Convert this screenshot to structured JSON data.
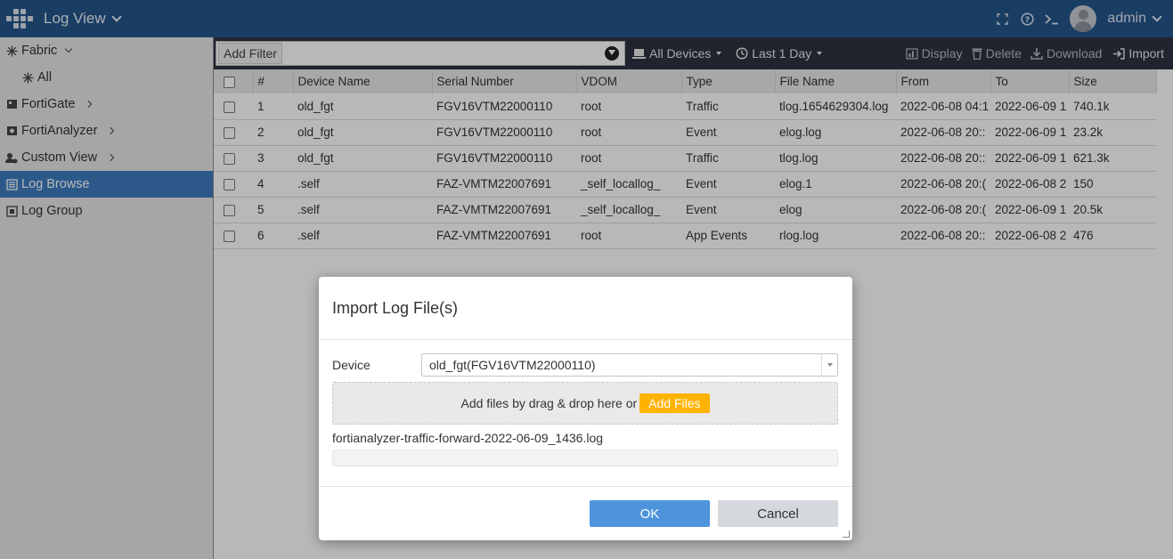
{
  "header": {
    "app_title": "Log View",
    "user": "admin"
  },
  "sidebar": {
    "items": [
      {
        "label": "Fabric"
      },
      {
        "label": "All"
      },
      {
        "label": "FortiGate"
      },
      {
        "label": "FortiAnalyzer"
      },
      {
        "label": "Custom View"
      },
      {
        "label": "Log Browse"
      },
      {
        "label": "Log Group"
      }
    ]
  },
  "toolbar": {
    "add_filter": "Add Filter",
    "devices": "All Devices",
    "time_range": "Last 1 Day",
    "display": "Display",
    "delete": "Delete",
    "download": "Download",
    "import": "Import"
  },
  "table": {
    "columns": [
      "#",
      "Device Name",
      "Serial Number",
      "VDOM",
      "Type",
      "File Name",
      "From",
      "To",
      "Size"
    ],
    "rows": [
      [
        "1",
        "old_fgt",
        "FGV16VTM22000110",
        "root",
        "Traffic",
        "tlog.1654629304.log",
        "2022-06-08 04:1",
        "2022-06-09 1",
        "740.1k"
      ],
      [
        "2",
        "old_fgt",
        "FGV16VTM22000110",
        "root",
        "Event",
        "elog.log",
        "2022-06-08 20::",
        "2022-06-09 1",
        "23.2k"
      ],
      [
        "3",
        "old_fgt",
        "FGV16VTM22000110",
        "root",
        "Traffic",
        "tlog.log",
        "2022-06-08 20::",
        "2022-06-09 1",
        "621.3k"
      ],
      [
        "4",
        ".self",
        "FAZ-VMTM22007691",
        "_self_locallog_",
        "Event",
        "elog.1",
        "2022-06-08 20:(",
        "2022-06-08 2",
        "150"
      ],
      [
        "5",
        ".self",
        "FAZ-VMTM22007691",
        "_self_locallog_",
        "Event",
        "elog",
        "2022-06-08 20:(",
        "2022-06-09 1",
        "20.5k"
      ],
      [
        "6",
        ".self",
        "FAZ-VMTM22007691",
        "root",
        "App Events",
        "rlog.log",
        "2022-06-08 20::",
        "2022-06-08 2",
        "476"
      ]
    ]
  },
  "modal": {
    "title": "Import Log File(s)",
    "device_label": "Device",
    "device_value": "old_fgt(FGV16VTM22000110)",
    "drop_text": "Add files by drag & drop here or",
    "add_files": "Add Files",
    "file_name": "fortianalyzer-traffic-forward-2022-06-09_1436.log",
    "progress": 0,
    "ok": "OK",
    "cancel": "Cancel"
  }
}
